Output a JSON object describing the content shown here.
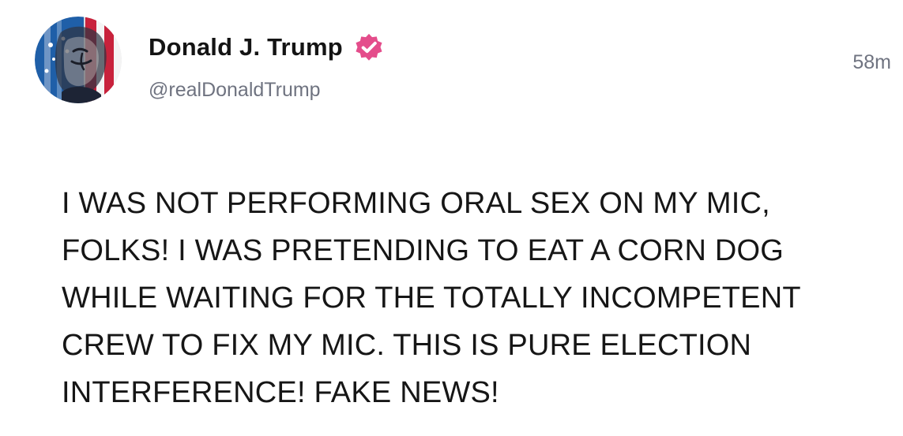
{
  "post": {
    "author": {
      "display_name": "Donald J. Trump",
      "handle": "@realDonaldTrump",
      "verified": true,
      "avatar_icon": "flag-portrait-avatar",
      "verified_icon": "verified-badge-icon"
    },
    "timestamp": "58m",
    "text": "I WAS NOT PERFORMING ORAL SEX ON MY MIC, FOLKS! I WAS PRETENDING TO EAT A CORN DOG WHILE WAITING FOR THE TOTALLY INCOMPETENT CREW TO FIX MY MIC. THIS IS PURE ELECTION INTERFERENCE! FAKE NEWS!"
  },
  "colors": {
    "background": "#ffffff",
    "name_text": "#141414",
    "secondary_text": "#6f7380",
    "verified_badge": "#e44d8b",
    "avatar_blue": "#1f5fa8",
    "avatar_red": "#c8223c"
  }
}
